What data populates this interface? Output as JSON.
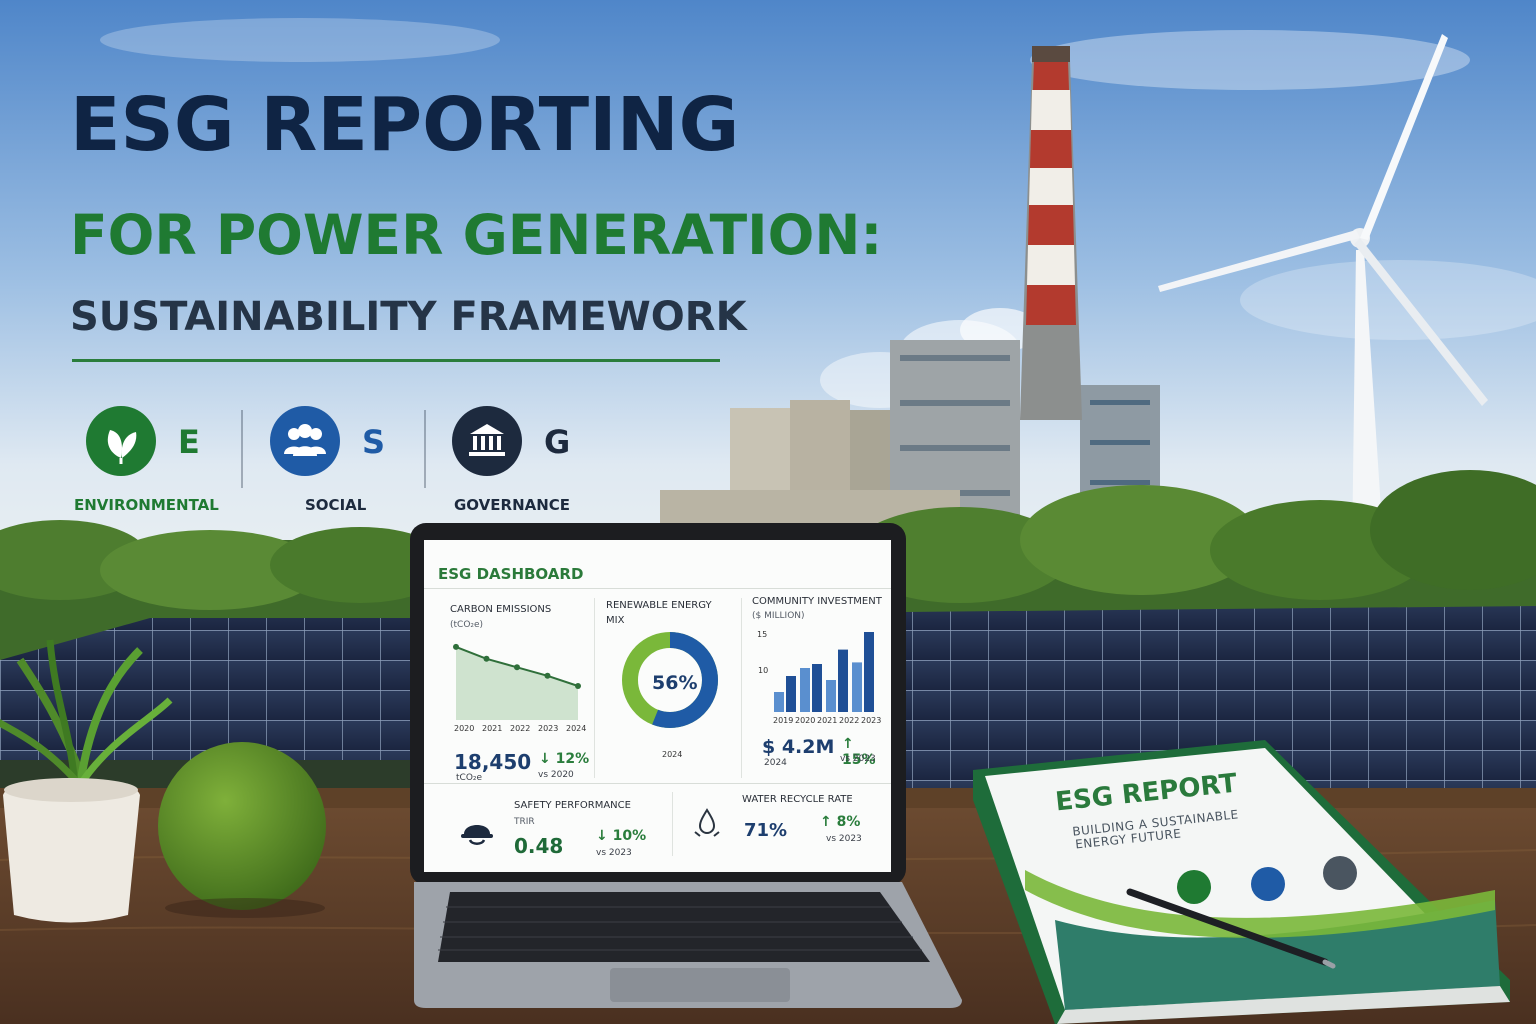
{
  "hero": {
    "title_line1": "ESG REPORTING",
    "title_line2": "FOR POWER GENERATION:",
    "title_line3": "SUSTAINABILITY FRAMEWORK"
  },
  "pillars": [
    {
      "letter": "E",
      "label": "ENVIRONMENTAL",
      "icon": "leaf-icon",
      "color": "#1f7a32"
    },
    {
      "letter": "S",
      "label": "SOCIAL",
      "icon": "people-icon",
      "color": "#1f5ba6"
    },
    {
      "letter": "G",
      "label": "GOVERNANCE",
      "icon": "institution-icon",
      "color": "#1d2a3e"
    }
  ],
  "dashboard": {
    "title": "ESG DASHBOARD",
    "carbon": {
      "label": "CARBON EMISSIONS",
      "unit": "(tCO₂e)",
      "years": [
        "2020",
        "2021",
        "2022",
        "2023",
        "2024"
      ],
      "value": "18,450",
      "value_unit": "tCO₂e",
      "delta": "↓ 12%",
      "compare": "vs 2020"
    },
    "renewable": {
      "label_line1": "RENEWABLE ENERGY",
      "label_line2": "MIX",
      "percent_label": "56%",
      "share": 0.56,
      "year": "2024"
    },
    "community": {
      "label": "COMMUNITY INVESTMENT",
      "unit": "($ MILLION)",
      "y_top": "15",
      "y_mid": "10",
      "years": [
        "2019",
        "2020",
        "2021",
        "2022",
        "2023"
      ],
      "value": "$ 4.2M",
      "delta": "↑ 15%",
      "compare": "vs 2023",
      "compare_year": "2024"
    },
    "safety": {
      "label": "SAFETY PERFORMANCE",
      "sub": "TRIR",
      "value": "0.48",
      "delta": "↓ 10%",
      "compare": "vs 2023"
    },
    "water": {
      "label": "WATER RECYCLE RATE",
      "value": "71%",
      "delta": "↑ 8%",
      "compare": "vs 2023"
    }
  },
  "report": {
    "title": "ESG REPORT",
    "subtitle_line1": "BUILDING A SUSTAINABLE",
    "subtitle_line2": "ENERGY FUTURE",
    "icons": [
      "leaf-icon",
      "people-icon",
      "institution-icon"
    ]
  },
  "colors": {
    "navy": "#0f2444",
    "green": "#1f7a32",
    "blue": "#1f5ba6"
  }
}
